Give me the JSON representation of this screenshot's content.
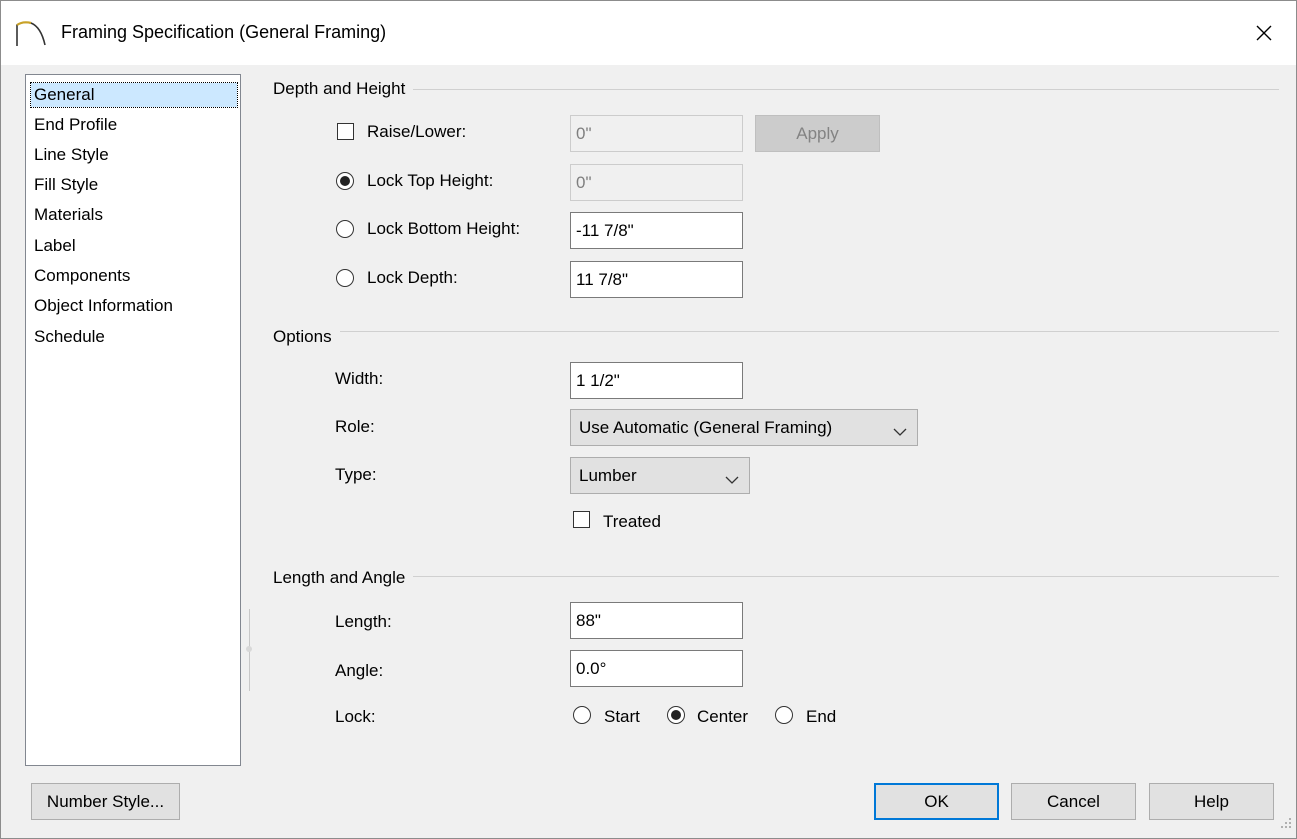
{
  "window": {
    "title": "Framing Specification (General Framing)"
  },
  "nav": {
    "items": [
      {
        "label": "General",
        "selected": true
      },
      {
        "label": "End Profile"
      },
      {
        "label": "Line Style"
      },
      {
        "label": "Fill Style"
      },
      {
        "label": "Materials"
      },
      {
        "label": "Label"
      },
      {
        "label": "Components"
      },
      {
        "label": "Object Information"
      },
      {
        "label": "Schedule"
      }
    ]
  },
  "depth_height": {
    "title": "Depth and Height",
    "raise_lower": {
      "label": "Raise/Lower:",
      "checked": false,
      "value": "0\"",
      "apply_label": "Apply"
    },
    "lock_top": {
      "label": "Lock Top Height:",
      "selected": true,
      "value": "0\""
    },
    "lock_bottom": {
      "label": "Lock Bottom Height:",
      "selected": false,
      "value": "-11 7/8\""
    },
    "lock_depth": {
      "label": "Lock Depth:",
      "selected": false,
      "value": "11 7/8\""
    }
  },
  "options": {
    "title": "Options",
    "width": {
      "label": "Width:",
      "value": "1 1/2\""
    },
    "role": {
      "label": "Role:",
      "value": "Use Automatic (General Framing)"
    },
    "type": {
      "label": "Type:",
      "value": "Lumber"
    },
    "treated": {
      "label": "Treated",
      "checked": false
    }
  },
  "length_angle": {
    "title": "Length and Angle",
    "length": {
      "label": "Length:",
      "value": "88\""
    },
    "angle": {
      "label": "Angle:",
      "value": "0.0°"
    },
    "lock": {
      "label": "Lock:",
      "options": [
        {
          "label": "Start",
          "selected": false
        },
        {
          "label": "Center",
          "selected": true
        },
        {
          "label": "End",
          "selected": false
        }
      ]
    }
  },
  "footer": {
    "number_style_label": "Number Style...",
    "ok_label": "OK",
    "cancel_label": "Cancel",
    "help_label": "Help"
  },
  "colors": {
    "accent": "#0078d7",
    "selection": "#cce8ff",
    "dialog_bg": "#f0f0f0"
  }
}
